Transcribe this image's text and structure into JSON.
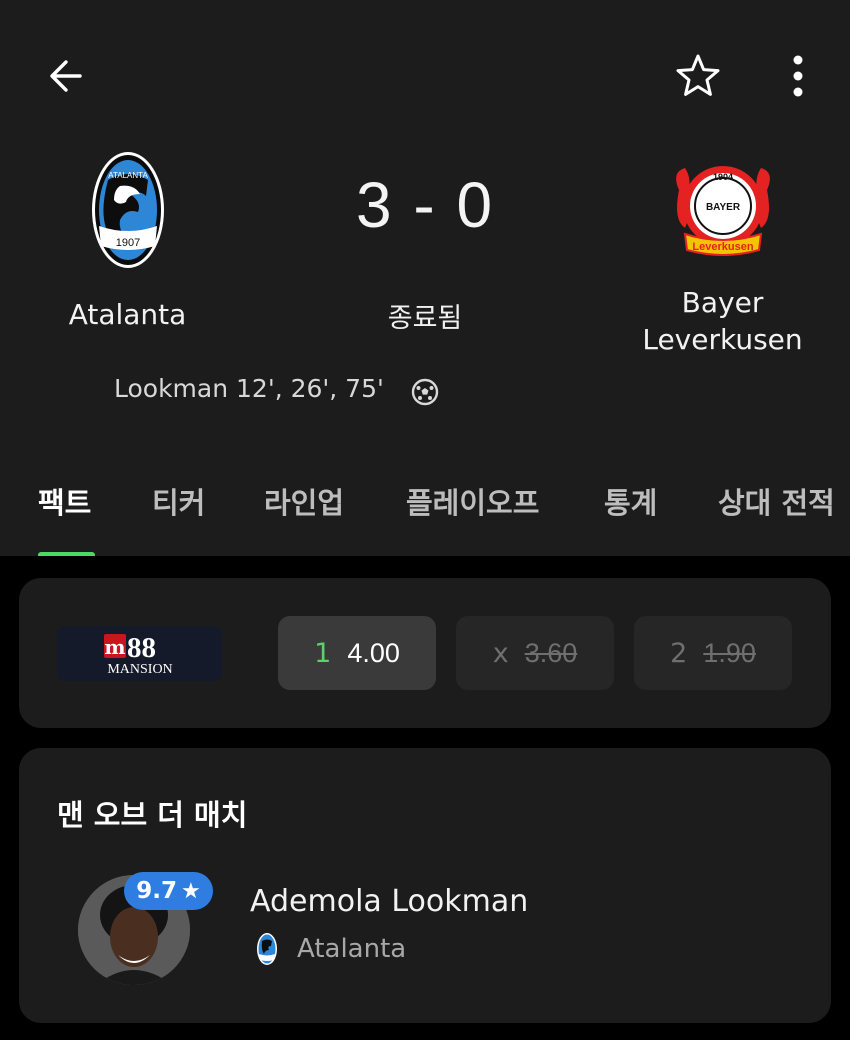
{
  "match": {
    "home_team": "Atalanta",
    "away_team": "Bayer\nLeverkusen",
    "score": "3 - 0",
    "status": "종료됨",
    "scorers_home": "Lookman 12', 26', 75'",
    "home_crest_year": "1907",
    "home_crest_text": "ATALANTA",
    "away_crest_year": "1904",
    "away_crest_text": "BAYER",
    "away_crest_banner": "Leverkusen"
  },
  "tabs": [
    {
      "label": "팩트",
      "active": true
    },
    {
      "label": "티커",
      "active": false
    },
    {
      "label": "라인업",
      "active": false
    },
    {
      "label": "플레이오프",
      "active": false
    },
    {
      "label": "통계",
      "active": false
    },
    {
      "label": "상대 전적",
      "active": false
    }
  ],
  "odds": {
    "provider": "M88",
    "provider_sub": "MANSION",
    "options": [
      {
        "label": "1",
        "value": "4.00",
        "selected": true,
        "struck": false
      },
      {
        "label": "x",
        "value": "3.60",
        "selected": false,
        "struck": true
      },
      {
        "label": "2",
        "value": "1.90",
        "selected": false,
        "struck": true
      }
    ]
  },
  "motm": {
    "title": "맨 오브 더 매치",
    "rating": "9.7",
    "player_name": "Ademola Lookman",
    "player_team": "Atalanta"
  },
  "colors": {
    "accent_green": "#4cd964",
    "rating_blue": "#2f7de1",
    "background": "#000000",
    "card": "#1c1c1c"
  },
  "icons": [
    "back-arrow-icon",
    "star-outline-icon",
    "more-vertical-icon",
    "soccer-ball-icon"
  ]
}
